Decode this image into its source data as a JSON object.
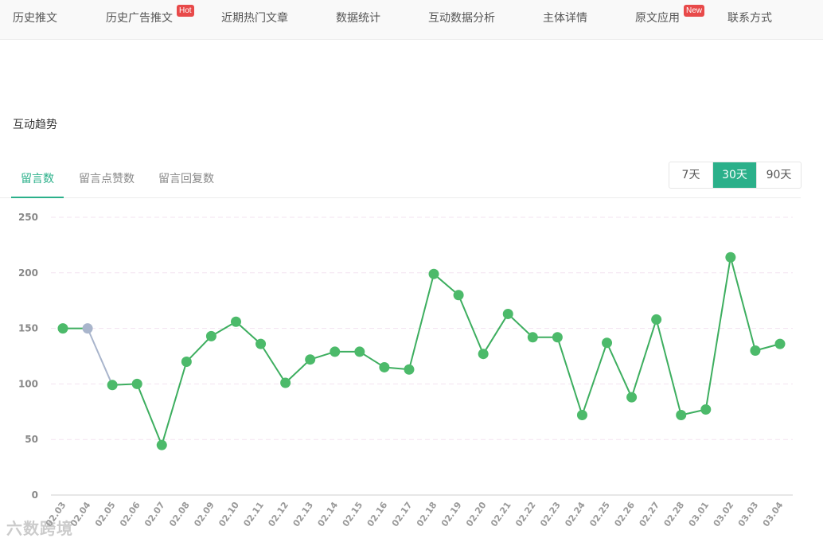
{
  "nav": {
    "items": [
      {
        "label": "历史推文",
        "active": true
      },
      {
        "label": "历史广告推文",
        "badge": "Hot"
      },
      {
        "label": "近期热门文章"
      },
      {
        "label": "数据统计"
      },
      {
        "label": "互动数据分析",
        "active": true
      },
      {
        "label": "主体详情"
      },
      {
        "label": "原文应用",
        "badge": "New"
      },
      {
        "label": "联系方式"
      }
    ]
  },
  "section": {
    "title": "互动趋势"
  },
  "subtabs": {
    "items": [
      "留言数",
      "留言点赞数",
      "留言回复数"
    ]
  },
  "range": {
    "items": [
      "7天",
      "30天",
      "90天"
    ],
    "selected": "30天"
  },
  "watermark": {
    "text": "六数跨境"
  },
  "colors": {
    "accent": "#2bb08a",
    "line": "#3dae5f",
    "point": "#4cba6a",
    "muted_point": "#a9b5cc",
    "badge": "#e84a4a"
  },
  "chart_data": {
    "type": "line",
    "ylim": [
      0,
      250
    ],
    "yticks": [
      0,
      50,
      100,
      150,
      200,
      250
    ],
    "grid": true,
    "x": [
      "02.03",
      "02.04",
      "02.05",
      "02.06",
      "02.07",
      "02.08",
      "02.09",
      "02.10",
      "02.11",
      "02.12",
      "02.13",
      "02.14",
      "02.15",
      "02.16",
      "02.17",
      "02.18",
      "02.19",
      "02.20",
      "02.21",
      "02.22",
      "02.23",
      "02.24",
      "02.25",
      "02.26",
      "02.27",
      "02.28",
      "03.01",
      "03.02",
      "03.03",
      "03.04"
    ],
    "values": [
      150,
      150,
      99,
      100,
      45,
      120,
      143,
      156,
      136,
      101,
      122,
      129,
      129,
      115,
      113,
      199,
      180,
      127,
      163,
      142,
      142,
      72,
      137,
      88,
      158,
      72,
      77,
      214,
      130,
      136
    ],
    "muted_index": 1
  }
}
